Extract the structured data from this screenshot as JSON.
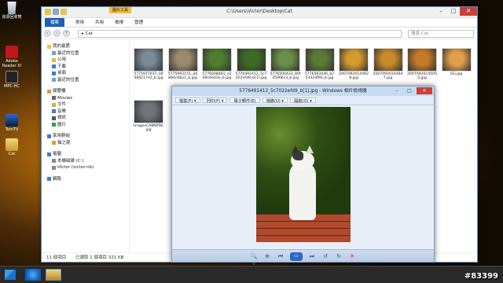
{
  "desktop": {
    "icons": [
      {
        "label": "資源回收筒",
        "name": "recycle-bin"
      },
      {
        "label": "Adobe Reader XI",
        "name": "adobe-reader"
      },
      {
        "label": "MPC-HC",
        "name": "mpc-hc"
      },
      {
        "label": "TomTV",
        "name": "tomtv"
      },
      {
        "label": "Cat",
        "name": "cat-folder"
      }
    ]
  },
  "explorer": {
    "title_path": "C:\\Users\\Victor\\Desktop\\Cat",
    "ribbon_context_tab": "圖片工具",
    "ribbon_tabs": [
      "檔案",
      "常用",
      "共用",
      "檢視",
      "管理"
    ],
    "address": "▸ Cat",
    "search_placeholder": "搜尋 Cat",
    "nav_items": [
      {
        "label": "我的最愛",
        "level": 0,
        "color": "#f3c431"
      },
      {
        "label": "最近的位置",
        "level": 1,
        "color": "#7a9dc7"
      },
      {
        "label": "公用",
        "level": 1,
        "color": "#e1b84b"
      },
      {
        "label": "下載",
        "level": 1,
        "color": "#3b7bd4"
      },
      {
        "label": "桌面",
        "level": 1,
        "color": "#3b7bd4"
      },
      {
        "label": "最近的位置",
        "level": 1,
        "color": "#7a9dc7"
      },
      {
        "label": "",
        "level": -1
      },
      {
        "label": "媒體櫃",
        "level": 0,
        "color": "#d2a13b"
      },
      {
        "label": "Movies",
        "level": 1,
        "color": "#666"
      },
      {
        "label": "文件",
        "level": 1,
        "color": "#d2b04b"
      },
      {
        "label": "音樂",
        "level": 1,
        "color": "#3b7bd4"
      },
      {
        "label": "視訊",
        "level": 1,
        "color": "#555"
      },
      {
        "label": "圖片",
        "level": 1,
        "color": "#3b9e4b"
      },
      {
        "label": "",
        "level": -1
      },
      {
        "label": "家用群組",
        "level": 0,
        "color": "#3b7bd4"
      },
      {
        "label": "猫之尾",
        "level": 1,
        "color": "#d2a13b"
      },
      {
        "label": "",
        "level": -1
      },
      {
        "label": "電腦",
        "level": 0,
        "color": "#3b7bd4"
      },
      {
        "label": "本機磁碟 (C:)",
        "level": 1,
        "color": "#888"
      },
      {
        "label": "Victor (victor-nb)",
        "level": 1,
        "color": "#888"
      },
      {
        "label": "",
        "level": -1
      },
      {
        "label": "網路",
        "level": 0,
        "color": "#3b7bd4"
      }
    ],
    "thumbnails": [
      {
        "caption": "5775977037_0446821741_b.jpg",
        "tone": "#7a8a96"
      },
      {
        "caption": "5775992151_dd884c0ba1_b.jpg",
        "tone": "#9c8a6e"
      },
      {
        "caption": "5776008481_e260c6e03e_b.jpg",
        "tone": "#4f7d2e"
      },
      {
        "caption": "5776491412_5c7022efd9_b[1].jpg",
        "tone": "#3d6a24"
      },
      {
        "caption": "5776500433_80f35066c3_b.jpg",
        "tone": "#6b8f4a"
      },
      {
        "caption": "5776583446_b253324f66_b.jpg",
        "tone": "#5a7a36"
      },
      {
        "caption": "20070920144928.jpg",
        "tone": "#d49a2e"
      },
      {
        "caption": "20070920144947.jpg",
        "tone": "#c98a2a"
      },
      {
        "caption": "20070920145050.jpg",
        "tone": "#c47a28"
      },
      {
        "caption": "GG.jpg",
        "tone": "#e0a04a"
      },
      {
        "caption": "imagesCA8NP5K.jpg",
        "tone": "#6f7478"
      }
    ],
    "status": {
      "count": "11 個項目",
      "selected": "已選取 1 個項目 321 KB"
    }
  },
  "viewer": {
    "title": "5776491412_5c7022efd9_b[1].jpg - Windows 相片檢視器",
    "menu": [
      "檔案(F) ▾",
      "列印(P) ▾",
      "電子郵件(E)",
      "燒錄(U) ▾",
      "開啟(O) ▾"
    ],
    "toolbar": [
      "🔍▾",
      "⊕",
      "⏮",
      "▭",
      "⏭",
      "↺",
      "↻",
      "✕"
    ]
  },
  "taskbar": {
    "watermark": "#83399"
  }
}
